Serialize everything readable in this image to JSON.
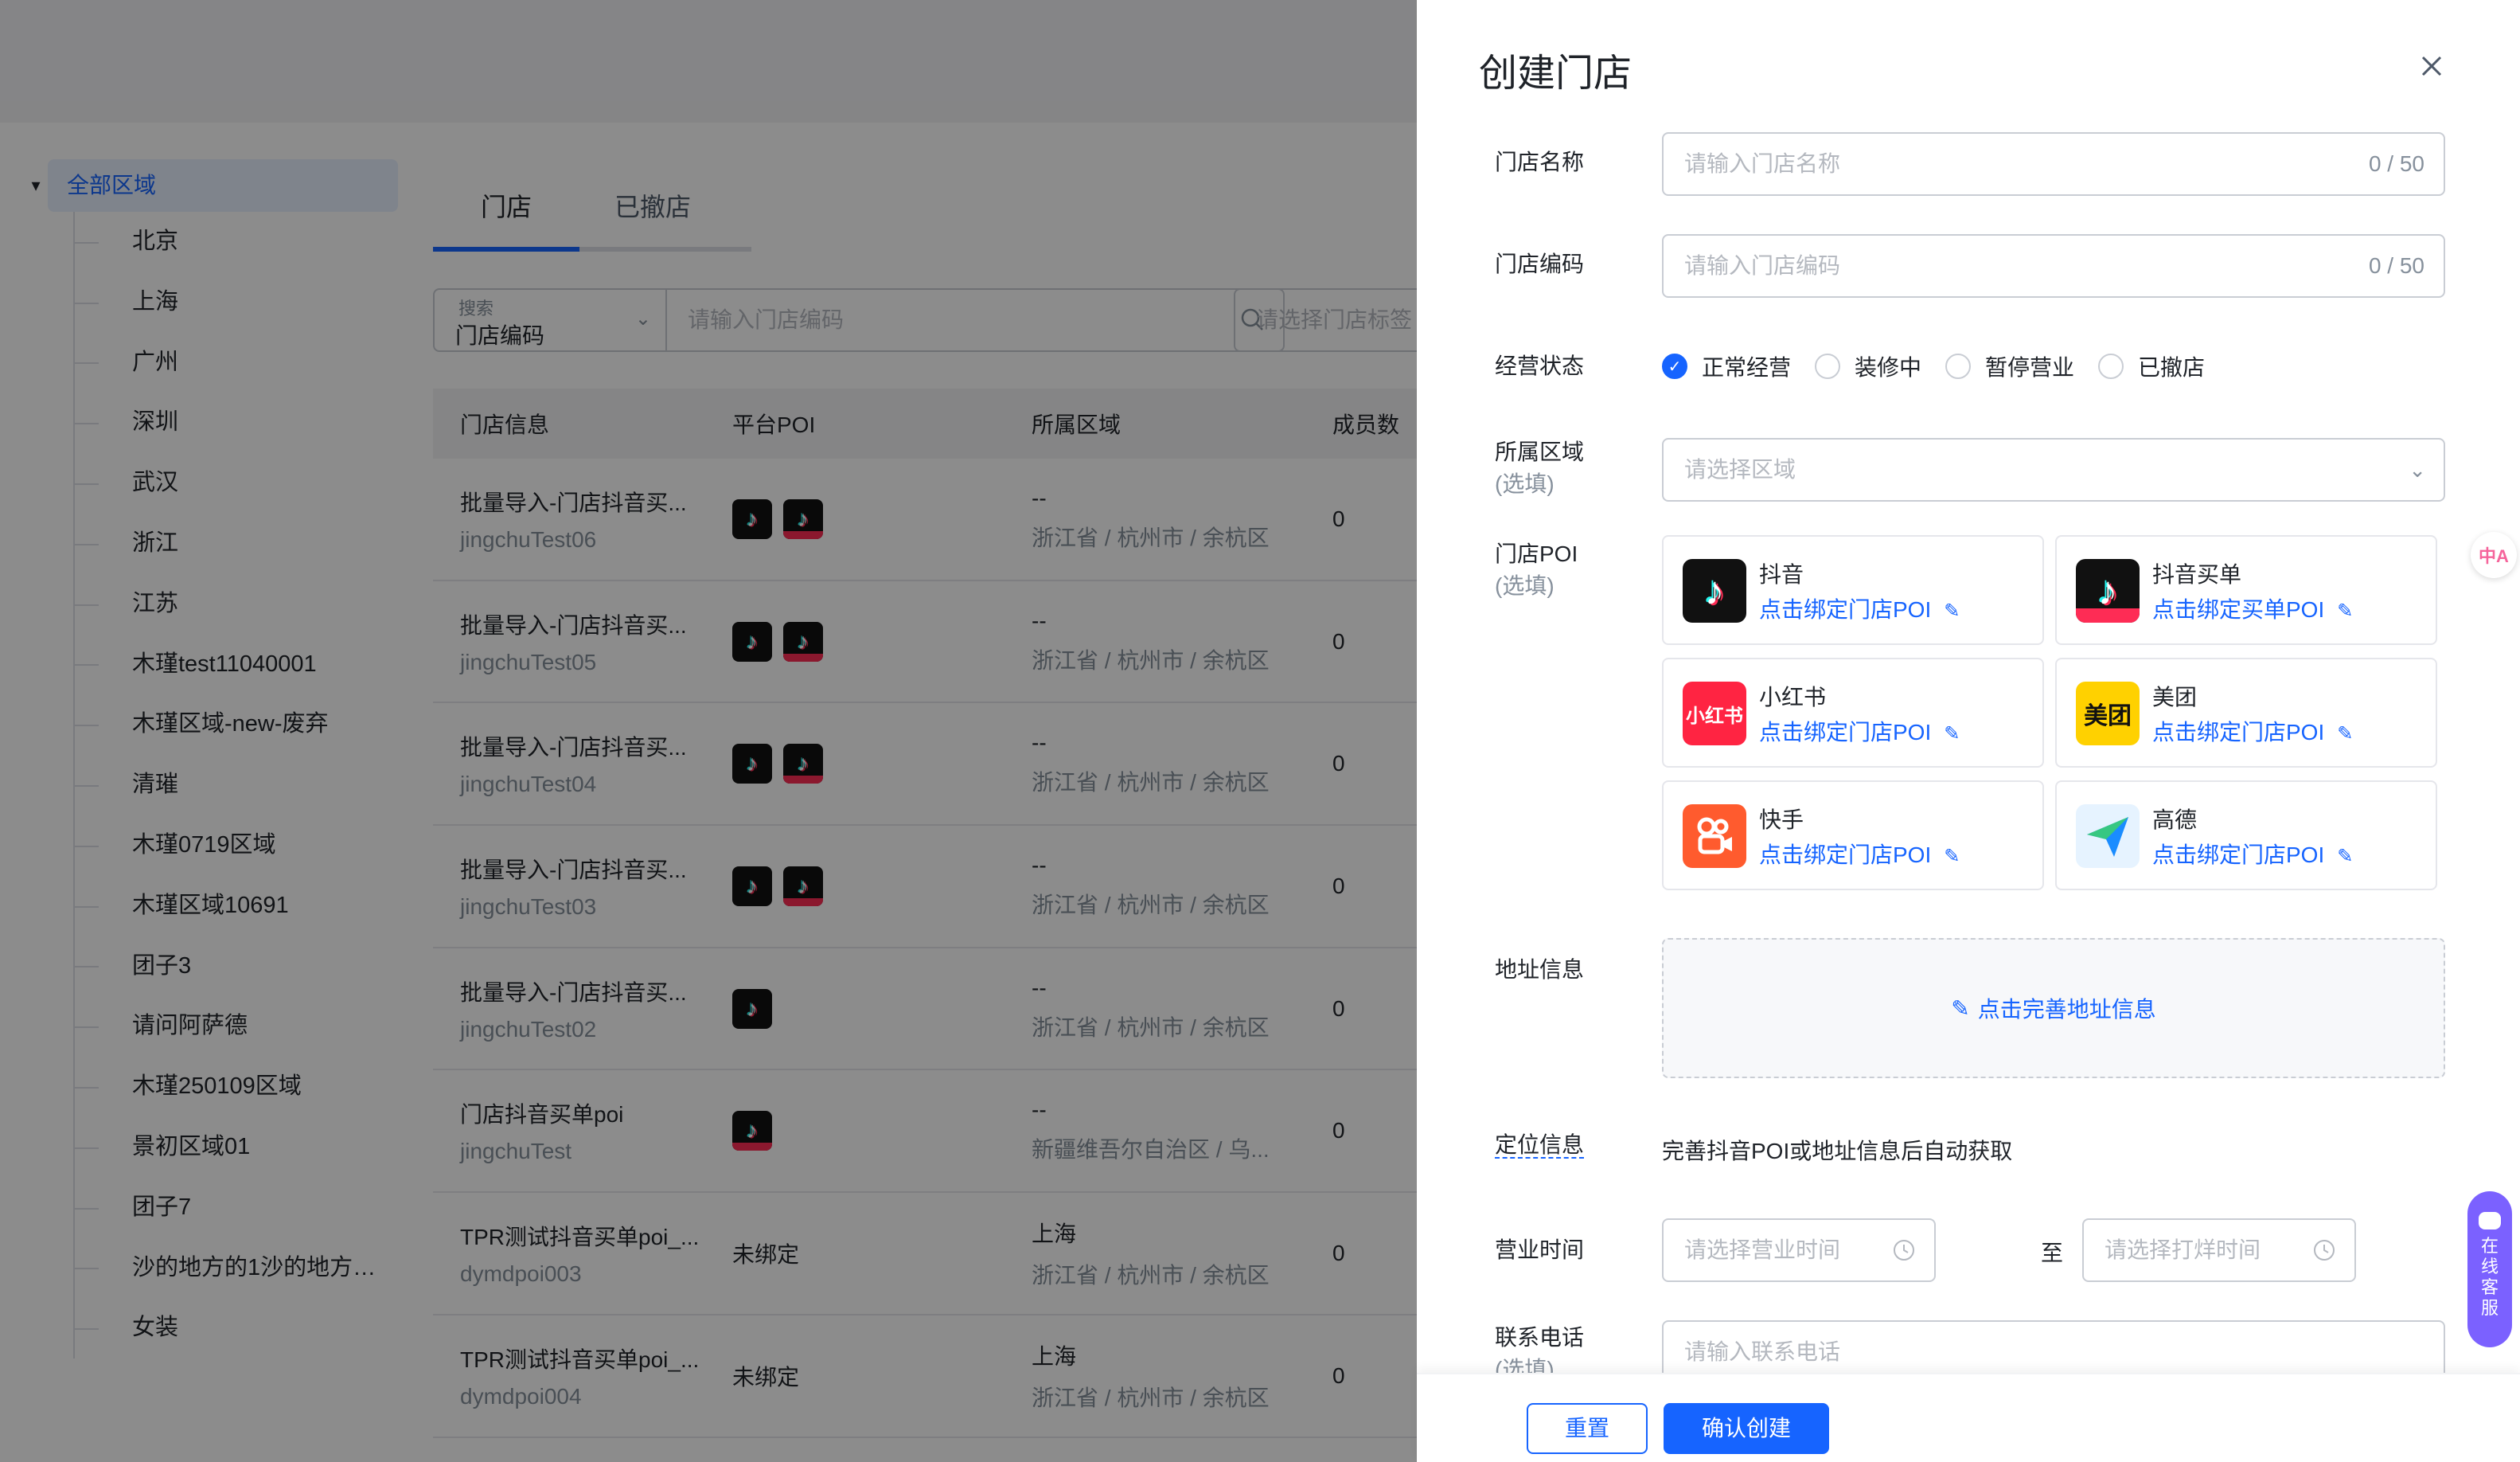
{
  "tree": {
    "root": "全部区域",
    "children": [
      "北京",
      "上海",
      "广州",
      "深圳",
      "武汉",
      "浙江",
      "江苏",
      "木瑾test11040001",
      "木瑾区域-new-废弃",
      "清璀",
      "木瑾0719区域",
      "木瑾区域10691",
      "团子3",
      "请问阿萨德",
      "木瑾250109区域",
      "景初区域01",
      "团子7",
      "沙的地方的1沙的地方的...",
      "女装"
    ]
  },
  "tabs": [
    "门店",
    "已撤店"
  ],
  "filter": {
    "label": "搜索",
    "select_value": "门店编码",
    "input_placeholder": "请输入门店编码",
    "tag_placeholder": "请选择门店标签"
  },
  "table": {
    "headers": [
      "门店信息",
      "平台POI",
      "所属区域",
      "成员数"
    ],
    "rows": [
      {
        "name": "批量导入-门店抖音买...",
        "code": "jingchuTest06",
        "poi": [
          "douyin",
          "douyin-buy"
        ],
        "poi_text": "",
        "region1": "--",
        "region2": "浙江省 / 杭州市 / 余杭区",
        "members": "0"
      },
      {
        "name": "批量导入-门店抖音买...",
        "code": "jingchuTest05",
        "poi": [
          "douyin",
          "douyin-buy"
        ],
        "poi_text": "",
        "region1": "--",
        "region2": "浙江省 / 杭州市 / 余杭区",
        "members": "0"
      },
      {
        "name": "批量导入-门店抖音买...",
        "code": "jingchuTest04",
        "poi": [
          "douyin",
          "douyin-buy"
        ],
        "poi_text": "",
        "region1": "--",
        "region2": "浙江省 / 杭州市 / 余杭区",
        "members": "0"
      },
      {
        "name": "批量导入-门店抖音买...",
        "code": "jingchuTest03",
        "poi": [
          "douyin",
          "douyin-buy"
        ],
        "poi_text": "",
        "region1": "--",
        "region2": "浙江省 / 杭州市 / 余杭区",
        "members": "0"
      },
      {
        "name": "批量导入-门店抖音买...",
        "code": "jingchuTest02",
        "poi": [
          "douyin"
        ],
        "poi_text": "",
        "region1": "--",
        "region2": "浙江省 / 杭州市 / 余杭区",
        "members": "0"
      },
      {
        "name": "门店抖音买单poi",
        "code": "jingchuTest",
        "poi": [
          "douyin-buy"
        ],
        "poi_text": "",
        "region1": "--",
        "region2": "新疆维吾尔自治区 / 乌...",
        "members": "0"
      },
      {
        "name": "TPR测试抖音买单poi_...",
        "code": "dymdpoi003",
        "poi": [],
        "poi_text": "未绑定",
        "region1": "上海",
        "region2": "浙江省 / 杭州市 / 余杭区",
        "members": "0"
      },
      {
        "name": "TPR测试抖音买单poi_...",
        "code": "dymdpoi004",
        "poi": [],
        "poi_text": "未绑定",
        "region1": "上海",
        "region2": "浙江省 / 杭州市 / 余杭区",
        "members": "0"
      }
    ]
  },
  "drawer": {
    "title": "创建门店",
    "store_name": {
      "label": "门店名称",
      "placeholder": "请输入门店名称",
      "count": "0 / 50"
    },
    "store_code": {
      "label": "门店编码",
      "placeholder": "请输入门店编码",
      "count": "0 / 50"
    },
    "status": {
      "label": "经营状态",
      "options": [
        "正常经营",
        "装修中",
        "暂停营业",
        "已撤店"
      ],
      "selected": "正常经营"
    },
    "region": {
      "label": "所属区域",
      "optional": "(选填)",
      "placeholder": "请选择区域"
    },
    "poi": {
      "label": "门店POI",
      "optional": "(选填)",
      "cards": [
        {
          "name": "抖音",
          "link": "点击绑定门店POI",
          "logo": "douyin-logo",
          "color": "#111111"
        },
        {
          "name": "抖音买单",
          "link": "点击绑定买单POI",
          "logo": "douyin-buy-logo",
          "color": "#111111"
        },
        {
          "name": "小红书",
          "link": "点击绑定门店POI",
          "logo": "xiaohongshu-logo",
          "color": "#ff2442",
          "logo_text": "小红书"
        },
        {
          "name": "美团",
          "link": "点击绑定门店POI",
          "logo": "meituan-logo",
          "color": "#ffd100",
          "logo_text": "美团"
        },
        {
          "name": "快手",
          "link": "点击绑定门店POI",
          "logo": "kuaishou-logo",
          "color": "#ff5b2e"
        },
        {
          "name": "高德",
          "link": "点击绑定门店POI",
          "logo": "amap-logo",
          "color": "#e6f3ff"
        }
      ]
    },
    "address": {
      "label": "地址信息",
      "action": "点击完善地址信息"
    },
    "locate": {
      "label": "定位信息",
      "text": "完善抖音POI或地址信息后自动获取"
    },
    "hours": {
      "label": "营业时间",
      "open_placeholder": "请选择营业时间",
      "to": "至",
      "close_placeholder": "请选择打烊时间"
    },
    "phone": {
      "label": "联系电话",
      "optional": "(选填)",
      "placeholder": "请输入联系电话"
    },
    "reset": "重置",
    "confirm": "确认创建"
  },
  "float": {
    "translate": "中A",
    "cs": [
      "在",
      "线",
      "客",
      "服"
    ]
  },
  "colors": {
    "accent": "#1664ff",
    "overlay": "rgba(0,0,0,0.45)"
  }
}
